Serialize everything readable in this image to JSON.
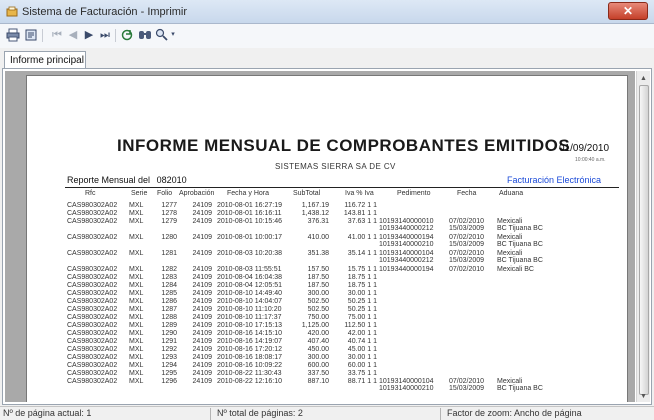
{
  "window": {
    "title": "Sistema de Facturación - Imprimir",
    "close_label": "✕"
  },
  "toolbar": {
    "buttons": [
      "print-icon",
      "page-setup-icon",
      "first-page-icon",
      "prev-page-icon",
      "next-page-icon",
      "last-page-icon",
      "refresh-icon",
      "find-icon",
      "zoom-icon"
    ]
  },
  "tabs": [
    "Informe principal"
  ],
  "report": {
    "title": "INFORME MENSUAL DE COMPROBANTES EMITIDOS",
    "date": "01/09/2010",
    "time": "10:00:40 a.m.",
    "company": "SISTEMAS SIERRA SA DE CV",
    "subtitle_label": "Reporte Mensual del",
    "subtitle_period": "082010",
    "facturacion": "Facturación Electrónica",
    "columns": [
      "Rfc",
      "Serie",
      "Folio",
      "Aprobación",
      "Fecha y Hora",
      "SubTotal",
      "Iva % Iva",
      "Pedimento",
      "Fecha",
      "Aduana"
    ],
    "rows": [
      {
        "rfc": "CAS980302A02",
        "serie": "MXL",
        "folio": "1277",
        "aprob": "24109",
        "fecha": "2010-08-01 16:27:19",
        "sub": "1,167.19",
        "iva": "116.72 1 1",
        "ped": "",
        "fechaped": "",
        "aduana": ""
      },
      {
        "rfc": "CAS980302A02",
        "serie": "MXL",
        "folio": "1278",
        "aprob": "24109",
        "fecha": "2010-08-01 16:16:11",
        "sub": "1,438.12",
        "iva": "143.81 1 1",
        "ped": "",
        "fechaped": "",
        "aduana": ""
      },
      {
        "rfc": "CAS980302A02",
        "serie": "MXL",
        "folio": "1279",
        "aprob": "24109",
        "fecha": "2010-08-01 10:15:46",
        "sub": "376.31",
        "iva": "37.63 1 1",
        "ped": "10193140000010\n10193440000212",
        "fechaped": "07/02/2010\n15/03/2009",
        "aduana": "Mexicali\nBC Tijuana BC"
      },
      {
        "rfc": "CAS980302A02",
        "serie": "MXL",
        "folio": "1280",
        "aprob": "24109",
        "fecha": "2010-08-01 10:00:17",
        "sub": "410.00",
        "iva": "41.00 1 1",
        "ped": "10193440000194\n10193140000210",
        "fechaped": "07/02/2010\n15/03/2009",
        "aduana": "Mexicali\nBC Tijuana BC"
      },
      {
        "rfc": "CAS980302A02",
        "serie": "MXL",
        "folio": "1281",
        "aprob": "24109",
        "fecha": "2010-08-03 10:20:38",
        "sub": "351.38",
        "iva": "35.14 1 1",
        "ped": "10193140000104\n10193440000212",
        "fechaped": "07/02/2010\n15/03/2009",
        "aduana": "Mexicali\nBC Tijuana BC"
      },
      {
        "rfc": "CAS980302A02",
        "serie": "MXL",
        "folio": "1282",
        "aprob": "24109",
        "fecha": "2010-08-03 11:55:51",
        "sub": "157.50",
        "iva": "15.75 1 1",
        "ped": "10193440000194",
        "fechaped": "07/02/2010",
        "aduana": "Mexicali BC"
      },
      {
        "rfc": "CAS980302A02",
        "serie": "MXL",
        "folio": "1283",
        "aprob": "24109",
        "fecha": "2010-08-04 16:04:38",
        "sub": "187.50",
        "iva": "18.75 1 1",
        "ped": "",
        "fechaped": "",
        "aduana": ""
      },
      {
        "rfc": "CAS980302A02",
        "serie": "MXL",
        "folio": "1284",
        "aprob": "24109",
        "fecha": "2010-08-04 12:05:51",
        "sub": "187.50",
        "iva": "18.75 1 1",
        "ped": "",
        "fechaped": "",
        "aduana": ""
      },
      {
        "rfc": "CAS980302A02",
        "serie": "MXL",
        "folio": "1285",
        "aprob": "24109",
        "fecha": "2010-08-10 14:49:40",
        "sub": "300.00",
        "iva": "30.00 1 1",
        "ped": "",
        "fechaped": "",
        "aduana": ""
      },
      {
        "rfc": "CAS980302A02",
        "serie": "MXL",
        "folio": "1286",
        "aprob": "24109",
        "fecha": "2010-08-10 14:04:07",
        "sub": "502.50",
        "iva": "50.25 1 1",
        "ped": "",
        "fechaped": "",
        "aduana": ""
      },
      {
        "rfc": "CAS980302A02",
        "serie": "MXL",
        "folio": "1287",
        "aprob": "24109",
        "fecha": "2010-08-10 11:10:20",
        "sub": "502.50",
        "iva": "50.25 1 1",
        "ped": "",
        "fechaped": "",
        "aduana": ""
      },
      {
        "rfc": "CAS980302A02",
        "serie": "MXL",
        "folio": "1288",
        "aprob": "24109",
        "fecha": "2010-08-10 11:17:37",
        "sub": "750.00",
        "iva": "75.00 1 1",
        "ped": "",
        "fechaped": "",
        "aduana": ""
      },
      {
        "rfc": "CAS980302A02",
        "serie": "MXL",
        "folio": "1289",
        "aprob": "24109",
        "fecha": "2010-08-10 17:15:13",
        "sub": "1,125.00",
        "iva": "112.50 1 1",
        "ped": "",
        "fechaped": "",
        "aduana": ""
      },
      {
        "rfc": "CAS980302A02",
        "serie": "MXL",
        "folio": "1290",
        "aprob": "24109",
        "fecha": "2010-08-16 14:15:10",
        "sub": "420.00",
        "iva": "42.00 1 1",
        "ped": "",
        "fechaped": "",
        "aduana": ""
      },
      {
        "rfc": "CAS980302A02",
        "serie": "MXL",
        "folio": "1291",
        "aprob": "24109",
        "fecha": "2010-08-16 14:19:07",
        "sub": "407.40",
        "iva": "40.74 1 1",
        "ped": "",
        "fechaped": "",
        "aduana": ""
      },
      {
        "rfc": "CAS980302A02",
        "serie": "MXL",
        "folio": "1292",
        "aprob": "24109",
        "fecha": "2010-08-16 17:20:12",
        "sub": "450.00",
        "iva": "45.00 1 1",
        "ped": "",
        "fechaped": "",
        "aduana": ""
      },
      {
        "rfc": "CAS980302A02",
        "serie": "MXL",
        "folio": "1293",
        "aprob": "24109",
        "fecha": "2010-08-16 18:08:17",
        "sub": "300.00",
        "iva": "30.00 1 1",
        "ped": "",
        "fechaped": "",
        "aduana": ""
      },
      {
        "rfc": "CAS980302A02",
        "serie": "MXL",
        "folio": "1294",
        "aprob": "24109",
        "fecha": "2010-08-16 10:09:22",
        "sub": "600.00",
        "iva": "60.00 1 1",
        "ped": "",
        "fechaped": "",
        "aduana": ""
      },
      {
        "rfc": "CAS980302A02",
        "serie": "MXL",
        "folio": "1295",
        "aprob": "24109",
        "fecha": "2010-08-22 11:30:43",
        "sub": "337.50",
        "iva": "33.75 1 1",
        "ped": "",
        "fechaped": "",
        "aduana": ""
      },
      {
        "rfc": "CAS980302A02",
        "serie": "MXL",
        "folio": "1296",
        "aprob": "24109",
        "fecha": "2010-08-22 12:16:10",
        "sub": "887.10",
        "iva": "88.71 1 1",
        "ped": "10193140000104\n10193140000210",
        "fechaped": "07/02/2010\n15/03/2009",
        "aduana": "Mexicali\nBC Tijuana BC"
      }
    ]
  },
  "status": {
    "current_page": "Nº de página actual: 1",
    "total_pages": "Nº total de páginas: 2",
    "zoom": "Factor de zoom: Ancho de página"
  }
}
